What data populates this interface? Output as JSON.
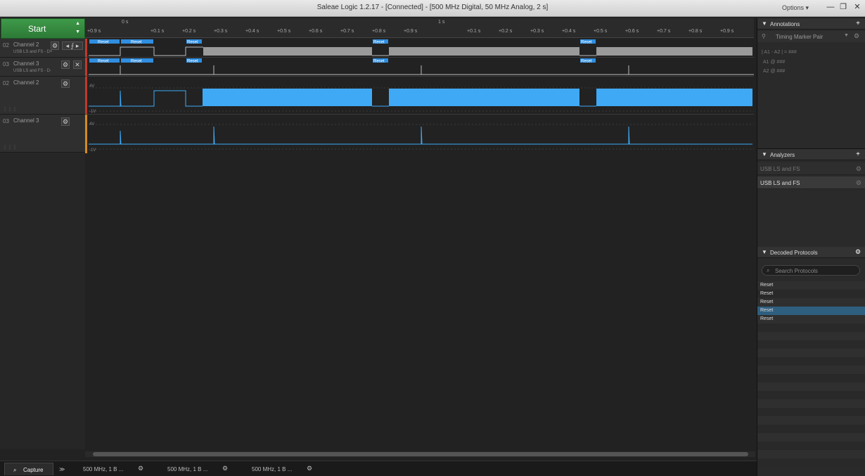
{
  "window": {
    "title": "Saleae Logic 1.2.17 - [Connected] - [500 MHz Digital, 50 MHz Analog, 2 s]",
    "options_label": "Options ▾",
    "controls": [
      "—",
      "❐",
      "✕"
    ]
  },
  "toolbar": {
    "start_label": "Start"
  },
  "ruler": {
    "major": [
      "0 s",
      "1 s"
    ],
    "ticks": [
      "+0.9 s",
      "+0.1 s",
      "+0.2 s",
      "+0.3 s",
      "+0.4 s",
      "+0.5 s",
      "+0.6 s",
      "+0.7 s",
      "+0.8 s",
      "+0.9 s",
      "+0.1 s",
      "+0.2 s",
      "+0.3 s",
      "+0.4 s",
      "+0.5 s",
      "+0.6 s",
      "+0.7 s",
      "+0.8 s",
      "+0.9 s"
    ]
  },
  "channels": [
    {
      "num": "02",
      "name": "Channel 2",
      "sub": "USB LS and FS - D+"
    },
    {
      "num": "03",
      "name": "Channel 3",
      "sub": "USB LS and FS - D-"
    },
    {
      "num": "02",
      "name": "Channel 2",
      "sub": ""
    },
    {
      "num": "03",
      "name": "Channel 3",
      "sub": ""
    }
  ],
  "waveform": {
    "reset_label": "Reset",
    "analog_high": "4V",
    "analog_low": "-1V",
    "colors": {
      "analog": "#3fa9f5",
      "reset_tag": "#2f8ee0",
      "digital_fill": "#9a9a9a",
      "marker_red": "#c0392b",
      "marker_orange": "#d58a1f"
    }
  },
  "annotations": {
    "header": "Annotations",
    "marker_pair": "Timing Marker Pair",
    "a1a2_label": "| A1 - A2 | = ###",
    "a1_label": "A1  @  ###",
    "a2_label": "A2  @  ###"
  },
  "analyzers": {
    "header": "Analyzers",
    "items": [
      "USB LS and FS",
      "USB LS and FS"
    ]
  },
  "decoded": {
    "header": "Decoded Protocols",
    "search_placeholder": "Search Protocols",
    "rows": [
      "Reset",
      "Reset",
      "Reset",
      "Reset",
      "Reset"
    ],
    "selected_index": 3
  },
  "tabs": {
    "capture": "Capture",
    "more": "≫",
    "sessions": [
      "500 MHz, 1 B ...",
      "500 MHz, 1 B ...",
      "500 MHz, 1 B ..."
    ]
  }
}
